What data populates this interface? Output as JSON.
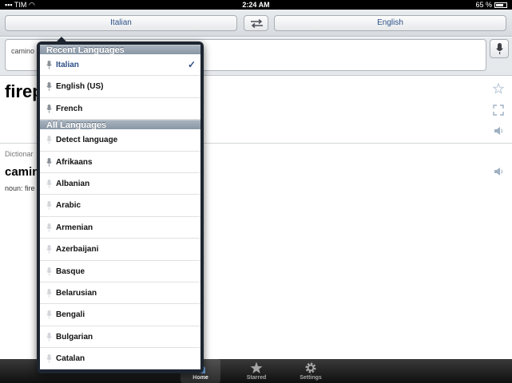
{
  "statusbar": {
    "carrier": "TIM",
    "time": "2:24 AM",
    "battery": "65 %"
  },
  "langbar": {
    "source_language": "Italian",
    "target_language": "English"
  },
  "input": {
    "text": "camino"
  },
  "result": {
    "word": "firep"
  },
  "dictionary": {
    "label": "Dictionar",
    "term": "camin",
    "noun": "noun: fire"
  },
  "popover": {
    "recent_header": "Recent Languages",
    "recent": [
      {
        "label": "Italian",
        "selected": true,
        "mic_active": true
      },
      {
        "label": "English (US)",
        "selected": false,
        "mic_active": true
      },
      {
        "label": "French",
        "selected": false,
        "mic_active": true
      }
    ],
    "all_header": "All Languages",
    "all": [
      {
        "label": "Detect language",
        "mic_active": false
      },
      {
        "label": "Afrikaans",
        "mic_active": true
      },
      {
        "label": "Albanian",
        "mic_active": false
      },
      {
        "label": "Arabic",
        "mic_active": false
      },
      {
        "label": "Armenian",
        "mic_active": false
      },
      {
        "label": "Azerbaijani",
        "mic_active": false
      },
      {
        "label": "Basque",
        "mic_active": false
      },
      {
        "label": "Belarusian",
        "mic_active": false
      },
      {
        "label": "Bengali",
        "mic_active": false
      },
      {
        "label": "Bulgarian",
        "mic_active": false
      },
      {
        "label": "Catalan",
        "mic_active": false
      }
    ],
    "check_glyph": "✓"
  },
  "tabbar": {
    "home_label": "Home",
    "starred_label": "Starred",
    "settings_label": "Settings"
  },
  "colors": {
    "accent": "#2d4f86",
    "section_header": "#8996a4",
    "tabbar": "#1a1a1a"
  }
}
